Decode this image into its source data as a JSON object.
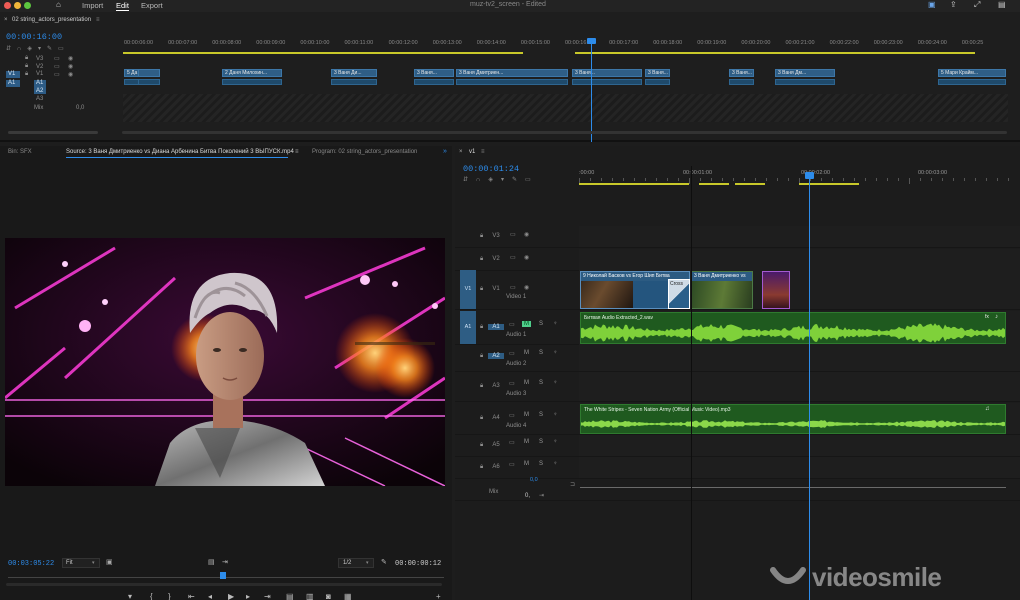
{
  "app": {
    "menu": [
      "Import",
      "Edit",
      "Export"
    ],
    "active_menu": "Edit",
    "window_title": "muz-tv2_screen",
    "window_status": "- Edited"
  },
  "upper_timeline": {
    "sequence_name": "02 string_actors_presentation",
    "timecode": "00:00:16:00",
    "ticks": [
      "00:00:06:00",
      "00:00:07:00",
      "00:00:08:00",
      "00:00:09:00",
      "00:00:10:00",
      "00:00:11:00",
      "00:00:12:00",
      "00:00:13:00",
      "00:00:14:00",
      "00:00:15:00",
      "00:00:16:00",
      "00:00:17:00",
      "00:00:18:00",
      "00:00:19:00",
      "00:00:20:00",
      "00:00:21:00",
      "00:00:22:00",
      "00:00:23:00",
      "00:00:24:00",
      "00:00:25"
    ],
    "tracks": [
      "V3",
      "V2",
      "V1",
      "A1",
      "A2",
      "A3",
      "Mix"
    ],
    "mix_value": "0,0",
    "clips": [
      "5 Да",
      "2 Даня Милохин...",
      "3 Ваня Ди...",
      "3 Ваня...",
      "3 Ваня Дмитриен...",
      "3 Ваня...",
      "3 Ваня...",
      "3 Ваня...",
      "3 Ваня Дм...",
      "5 Мари Крайм..."
    ]
  },
  "source_panel": {
    "tabs": [
      "Bin: SFX",
      "Source: 3 Ваня Дмитриенко vs Диана Арбенина  Битва Поколений  3 ВЫПУСК.mp4",
      "Program: 02 string_actors_presentation"
    ],
    "timecode_left": "00:03:05:22",
    "fit": "Fit",
    "ratio": "1/2",
    "timecode_right": "00:00:00:12"
  },
  "sequence": {
    "name": "v1",
    "timecode": "00:00:01:24",
    "ticks": [
      ":00:00",
      "00:00:01:00",
      "00:00:02:00",
      "00:00:03:00"
    ],
    "video_tracks": [
      {
        "id": "V3",
        "name": ""
      },
      {
        "id": "V2",
        "name": ""
      },
      {
        "id": "V1",
        "name": "Video 1",
        "src": "V1"
      }
    ],
    "audio_tracks": [
      {
        "id": "A1",
        "name": "Audio 1",
        "src": "A1"
      },
      {
        "id": "A2",
        "name": "Audio 2"
      },
      {
        "id": "A3",
        "name": "Audio 3"
      },
      {
        "id": "A4",
        "name": "Audio 4"
      },
      {
        "id": "A5",
        "name": ""
      },
      {
        "id": "A6",
        "name": ""
      }
    ],
    "mix": {
      "label": "Mix",
      "value": "0,",
      "center": "0,0"
    },
    "clips": {
      "video1": "9 Николай Басков vs Егор Шип",
      "video1b": "Битва",
      "cross": "Cross",
      "video2": "3 Ваня Дмитриенко vs",
      "audio1": "Битвая Audio Extracted_2.wav",
      "audio4": "The White Stripes - Seven Nation Army (Official Music Video).mp3"
    },
    "track_buttons": {
      "m": "M",
      "s": "S"
    }
  },
  "watermark": "videosmile"
}
